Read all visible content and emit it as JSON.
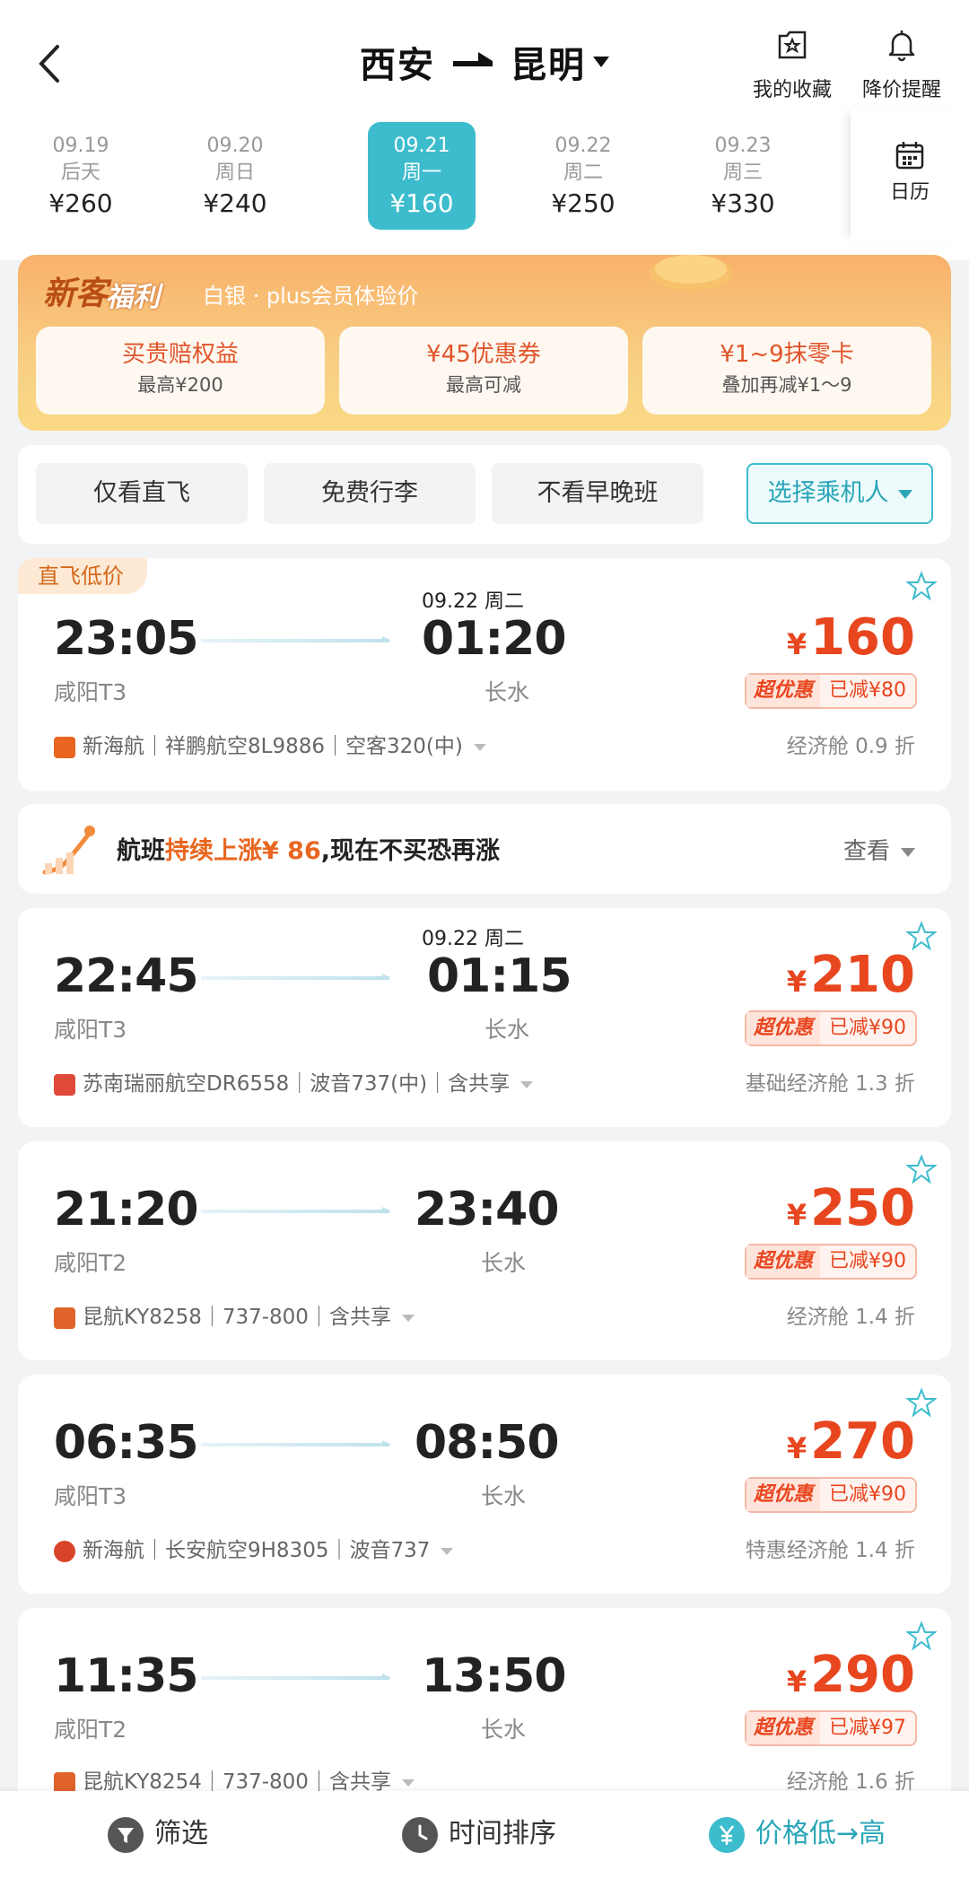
{
  "header": {
    "from": "西安",
    "to": "昆明",
    "favorites_label": "我的收藏",
    "price_alert_label": "降价提醒"
  },
  "dates": [
    {
      "date": "09.19",
      "weekday": "后天",
      "price": "¥260"
    },
    {
      "date": "09.20",
      "weekday": "周日",
      "price": "¥240"
    },
    {
      "date": "09.21",
      "weekday": "周一",
      "price": "¥160",
      "selected": true
    },
    {
      "date": "09.22",
      "weekday": "周二",
      "price": "¥250"
    },
    {
      "date": "09.23",
      "weekday": "周三",
      "price": "¥330"
    }
  ],
  "calendar_label": "日历",
  "promo": {
    "title_a": "新客",
    "title_b": "福利",
    "subtitle": "白银 · plus会员体验价",
    "cards": [
      {
        "title": "买贵赔权益",
        "sub": "最高¥200"
      },
      {
        "title": "¥45优惠券",
        "sub": "最高可减"
      },
      {
        "title": "¥1~9抹零卡",
        "sub": "叠加再减¥1～9"
      }
    ]
  },
  "filters": [
    "仅看直飞",
    "免费行李",
    "不看早晚班"
  ],
  "passenger_select": "选择乘机人",
  "flights": [
    {
      "tag": "直飞低价",
      "next_day": "09.22 周二",
      "dep": "23:05",
      "arr": "01:20",
      "dep_ap": "咸阳T3",
      "arr_ap": "长水",
      "price": "160",
      "promo": "超优惠",
      "discount": "已减¥80",
      "airline": "新海航｜祥鹏航空8L9886｜空客320(中)",
      "cabin": "经济舱 0.9 折",
      "logo_color": "#e8661f"
    },
    {
      "next_day": "09.22 周二",
      "dep": "22:45",
      "arr": "01:15",
      "dep_ap": "咸阳T3",
      "arr_ap": "长水",
      "price": "210",
      "promo": "超优惠",
      "discount": "已减¥90",
      "airline": "苏南瑞丽航空DR6558｜波音737(中)｜含共享",
      "cabin": "基础经济舱 1.3 折",
      "logo_color": "#e04a3a"
    },
    {
      "dep": "21:20",
      "arr": "23:40",
      "dep_ap": "咸阳T2",
      "arr_ap": "长水",
      "price": "250",
      "promo": "超优惠",
      "discount": "已减¥90",
      "airline": "昆航KY8258｜737-800｜含共享",
      "cabin": "经济舱 1.4 折",
      "logo_color": "#e0642a"
    },
    {
      "dep": "06:35",
      "arr": "08:50",
      "dep_ap": "咸阳T3",
      "arr_ap": "长水",
      "price": "270",
      "promo": "超优惠",
      "discount": "已减¥90",
      "airline": "新海航｜长安航空9H8305｜波音737",
      "cabin": "特惠经济舱 1.4 折",
      "logo_color": "#d8442a"
    },
    {
      "dep": "11:35",
      "arr": "13:50",
      "dep_ap": "咸阳T2",
      "arr_ap": "长水",
      "price": "290",
      "promo": "超优惠",
      "discount": "已减¥97",
      "airline": "昆航KY8254｜737-800｜含共享",
      "cabin": "经济舱 1.6 折",
      "logo_color": "#e0642a"
    }
  ],
  "alert": {
    "pre": "航班",
    "highlight": "持续上涨¥ 86",
    "post": ",现在不买恐再涨",
    "action": "查看"
  },
  "bottom": {
    "filter": "筛选",
    "time_sort": "时间排序",
    "price_sort": "价格低→高"
  },
  "colors": {
    "accent": "#3dbccd",
    "price": "#e8461f"
  }
}
